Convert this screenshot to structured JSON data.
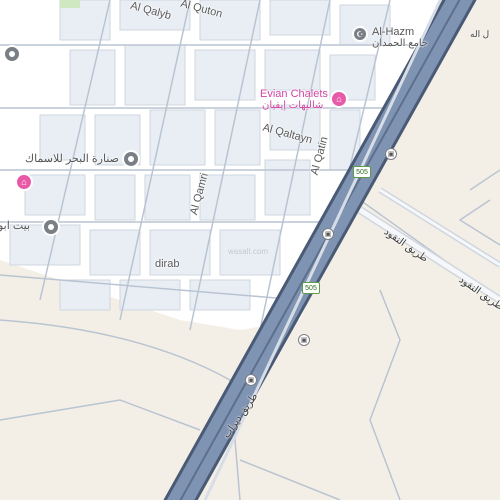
{
  "map": {
    "colors": {
      "land": "#f4efe6",
      "urban": "#ffffff",
      "block": "#e9eef5",
      "block_stroke": "#cfd6df",
      "highway_fill": "#7f93b3",
      "highway_casing": "#5d6f8c",
      "highway_dark": "#4a5a75",
      "minor_line": "#b9c4d2",
      "poi_pink": "#e85aa8",
      "poi_grey": "#7a7f86",
      "shield_green": "#5d9b4b"
    },
    "streets": {
      "al_qalyb": "Al Qalyb",
      "al_quton": "Al Quton",
      "al_qaltayn": "Al Qaltayn",
      "al_qamri": "Al Qamri",
      "al_qatin": "Al Qatin",
      "dirab": "dirab"
    },
    "pois": {
      "al_hazm": {
        "name": "Al-Hazm",
        "name_ar": "جامع الحمدان",
        "icon": "mosque-icon"
      },
      "evian": {
        "name": "Evian Chalets",
        "name_ar": "شاليهات إيفيان",
        "icon": "chalet-icon"
      },
      "fish": {
        "name": "صنارة البحر للاسماك",
        "icon": "pin-icon"
      },
      "bayt": {
        "name": "بيت ابو",
        "icon": "pin-icon"
      },
      "pink_left": {
        "icon": "chalet-icon"
      },
      "grey_top": {
        "icon": "pin-icon"
      }
    },
    "roads": {
      "dirab_road_ar": "طريق ديراب",
      "nuqud_1": "طريق النقود",
      "nuqud_2": "طريق النقود"
    },
    "shields": {
      "s1": "505",
      "s2": "505"
    },
    "watermark": "wasalt.com",
    "partial_corner": "ل اله"
  }
}
